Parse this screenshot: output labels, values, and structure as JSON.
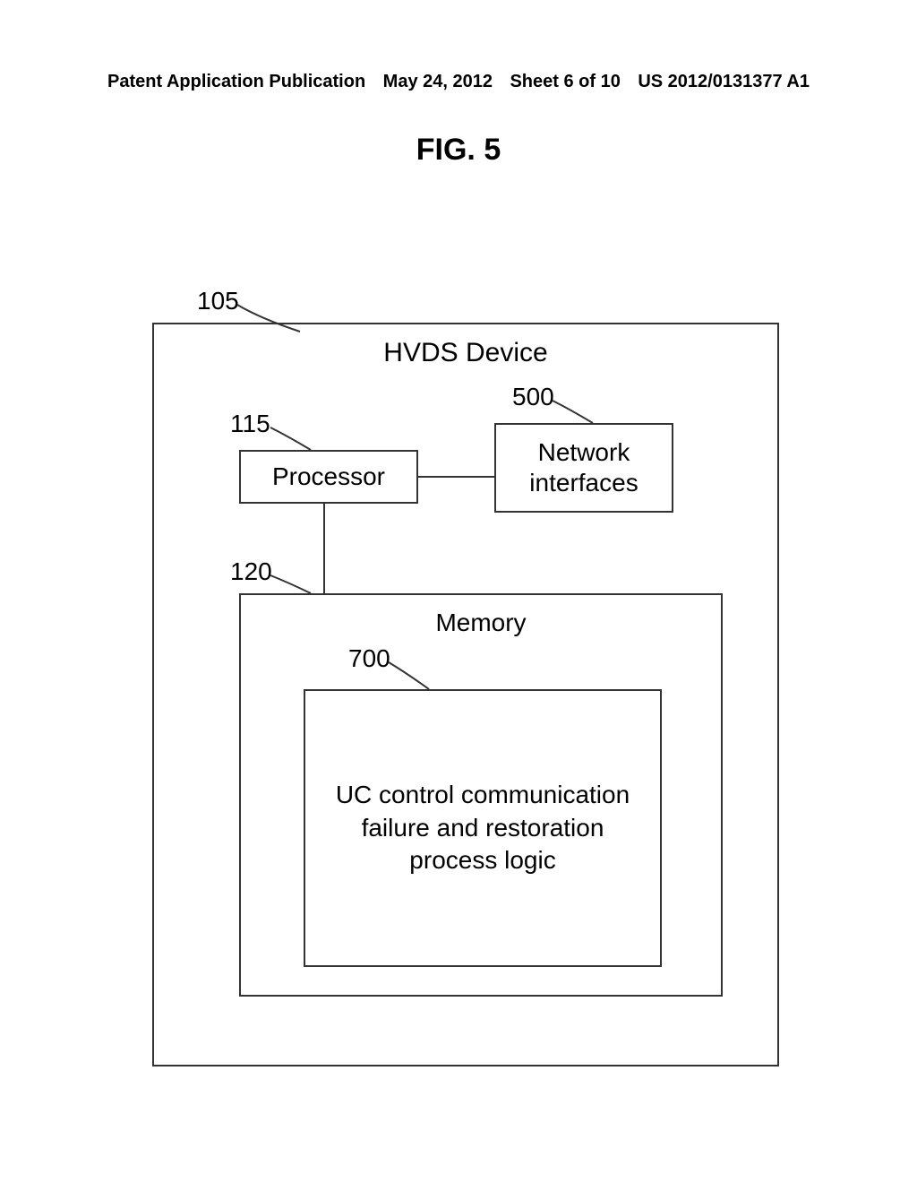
{
  "header": {
    "publication": "Patent Application Publication",
    "date": "May 24, 2012",
    "sheet": "Sheet 6 of 10",
    "patent_no": "US 2012/0131377 A1"
  },
  "figure": {
    "title": "FIG. 5"
  },
  "diagram": {
    "outer": {
      "ref": "105",
      "title": "HVDS Device"
    },
    "processor": {
      "ref": "115",
      "label": "Processor"
    },
    "network": {
      "ref": "500",
      "label": "Network interfaces"
    },
    "memory": {
      "ref": "120",
      "label": "Memory"
    },
    "uc": {
      "ref": "700",
      "label": "UC control communication failure and restoration process logic"
    }
  }
}
